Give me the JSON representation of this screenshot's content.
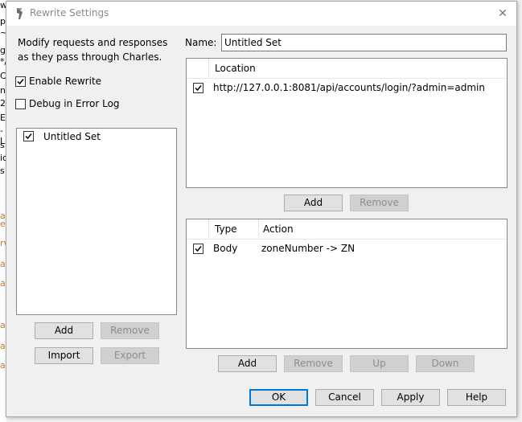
{
  "background": {
    "fragments": [
      "w",
      "p",
      "~1",
      "g",
      "*/",
      "Co",
      "n-",
      "27",
      "Er",
      "-L",
      "s",
      "ic",
      "s"
    ],
    "accent_fragments": [
      "a",
      "e",
      "rv",
      "a",
      "a",
      "a",
      "a",
      "a"
    ]
  },
  "window": {
    "title": "Rewrite Settings",
    "close_glyph": "✕"
  },
  "left": {
    "description_line1": "Modify requests and responses",
    "description_line2": "as they pass through Charles.",
    "enable_rewrite": {
      "label": "Enable Rewrite",
      "checked": true
    },
    "debug_log": {
      "label": "Debug in Error Log",
      "checked": false
    },
    "sets": [
      {
        "label": "Untitled Set",
        "checked": true
      }
    ],
    "buttons": {
      "add": "Add",
      "remove": "Remove",
      "import": "Import",
      "export": "Export"
    }
  },
  "name": {
    "label": "Name:",
    "value": "Untitled Set"
  },
  "locations": {
    "header": "Location",
    "rows": [
      {
        "checked": true,
        "location": "http://127.0.0.1:8081/api/accounts/login/?admin=admin"
      }
    ],
    "buttons": {
      "add": "Add",
      "remove": "Remove"
    }
  },
  "rules": {
    "headers": {
      "type": "Type",
      "action": "Action"
    },
    "rows": [
      {
        "checked": true,
        "type": "Body",
        "action": "zoneNumber -> ZN"
      }
    ],
    "buttons": {
      "add": "Add",
      "remove": "Remove",
      "up": "Up",
      "down": "Down"
    }
  },
  "footer": {
    "ok": "OK",
    "cancel": "Cancel",
    "apply": "Apply",
    "help": "Help"
  },
  "colors": {
    "default_button_border": "#0078d7",
    "panel_border": "#828790",
    "accent_text": "#c07a2a"
  }
}
